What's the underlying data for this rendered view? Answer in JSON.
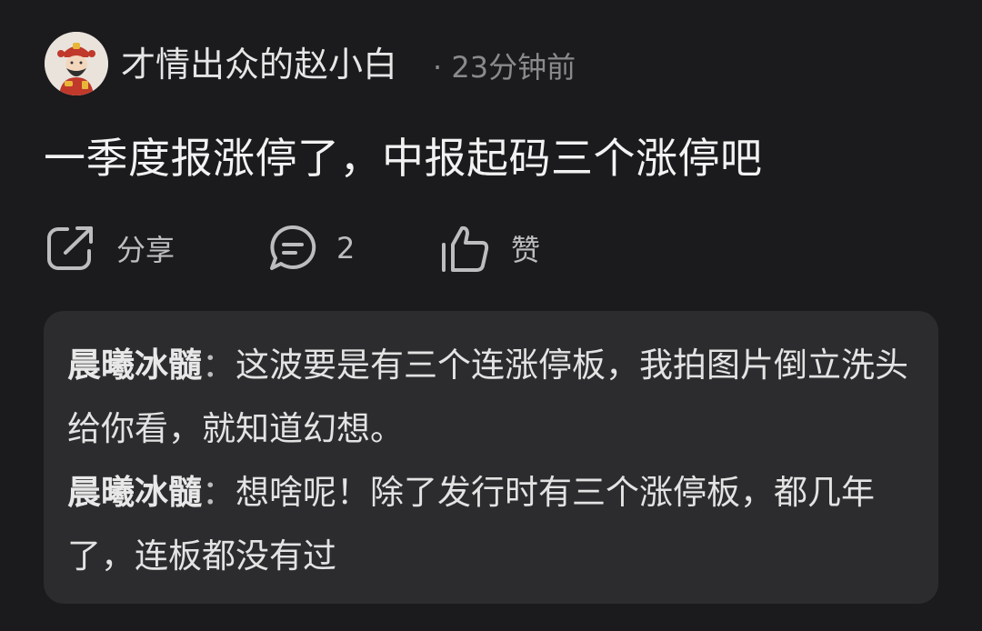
{
  "post": {
    "username": "才情出众的赵小白",
    "timestamp": "· 23分钟前",
    "content": "一季度报涨停了，中报起码三个涨停吧"
  },
  "actions": {
    "share": {
      "icon": "share-icon",
      "label": "分享"
    },
    "comment": {
      "icon": "comment-icon",
      "count": "2"
    },
    "like": {
      "icon": "thumbs-up-icon",
      "label": "赞"
    }
  },
  "replies": [
    {
      "name": "晨曦冰髓",
      "separator": "：",
      "text": "这波要是有三个连涨停板，我拍图片倒立洗头给你看，就知道幻想。"
    },
    {
      "name": "晨曦冰髓",
      "separator": "：",
      "text": "想啥呢！除了发行时有三个涨停板，都几年了，连板都没有过"
    }
  ],
  "colors": {
    "background": "#1b1a1c",
    "reply_panel": "#2c2b2e",
    "primary_text": "#f2f2f2",
    "muted_text": "#8a8a8d"
  }
}
